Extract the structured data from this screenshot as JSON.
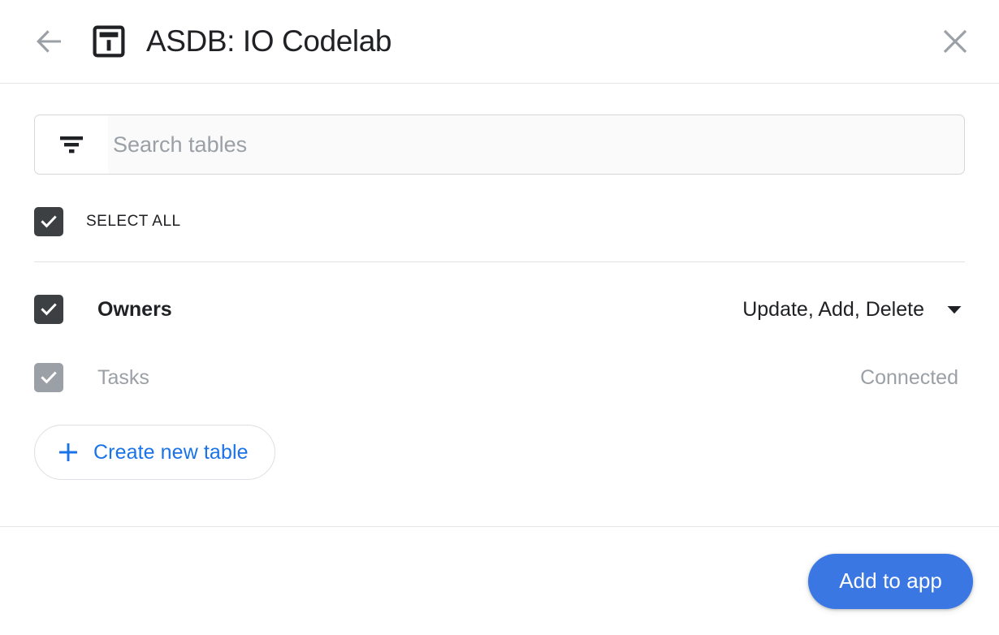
{
  "header": {
    "back_icon": "arrow-left-icon",
    "app_icon": "table-icon",
    "title": "ASDB: IO Codelab",
    "close_icon": "close-icon"
  },
  "search": {
    "filter_icon": "filter-icon",
    "placeholder": "Search tables",
    "value": ""
  },
  "select_all": {
    "label": "SELECT ALL",
    "checked": true
  },
  "tables": [
    {
      "name": "Owners",
      "checked": true,
      "enabled": true,
      "permissions": "Update, Add, Delete",
      "caret_icon": "chevron-down-icon"
    },
    {
      "name": "Tasks",
      "checked": true,
      "enabled": false,
      "status": "Connected"
    }
  ],
  "create_table": {
    "plus_icon": "plus-icon",
    "label": "Create new table"
  },
  "footer": {
    "primary_label": "Add to app"
  },
  "colors": {
    "accent_blue": "#1a73e8",
    "button_blue": "#3b77e3",
    "checkbox_dark": "#3c4043",
    "muted_gray": "#9aa0a6",
    "divider": "#e4e6e8"
  }
}
